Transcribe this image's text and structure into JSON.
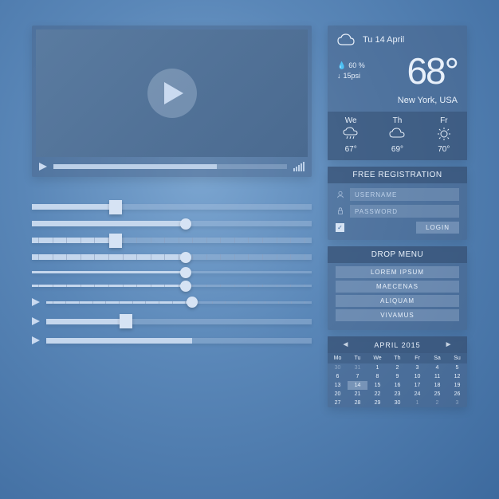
{
  "video": {
    "progress_pct": 70
  },
  "sliders": [
    {
      "fill": 30,
      "thumb": "square",
      "thin": false,
      "ticks": false,
      "play": false
    },
    {
      "fill": 55,
      "thumb": "round",
      "thin": false,
      "ticks": false,
      "play": false
    },
    {
      "fill": 30,
      "thumb": "square",
      "thin": false,
      "ticks": true,
      "play": false
    },
    {
      "fill": 55,
      "thumb": "round",
      "thin": false,
      "ticks": true,
      "play": false
    },
    {
      "fill": 55,
      "thumb": "round",
      "thin": true,
      "ticks": false,
      "play": false
    },
    {
      "fill": 55,
      "thumb": "round",
      "thin": true,
      "ticks": true,
      "play": false
    },
    {
      "fill": 55,
      "thumb": "round",
      "thin": true,
      "ticks": true,
      "play": true
    },
    {
      "fill": 30,
      "thumb": "square",
      "thin": false,
      "ticks": false,
      "play": true
    },
    {
      "fill": 55,
      "thumb": "none",
      "thin": false,
      "ticks": false,
      "play": true
    }
  ],
  "weather": {
    "date": "Tu 14 April",
    "humidity": "60 %",
    "pressure": "15psi",
    "temp": "68°",
    "location": "New York, USA",
    "forecast": [
      {
        "day": "We",
        "temp": "67°",
        "icon": "rain"
      },
      {
        "day": "Th",
        "temp": "69°",
        "icon": "cloud"
      },
      {
        "day": "Fr",
        "temp": "70°",
        "icon": "sun"
      }
    ]
  },
  "registration": {
    "title": "FREE REGISTRATION",
    "username_ph": "USERNAME",
    "password_ph": "PASSWORD",
    "login_label": "LOGIN"
  },
  "menu": {
    "title": "DROP MENU",
    "items": [
      "LOREM IPSUM",
      "MAECENAS",
      "ALIQUAM",
      "VIVAMUS"
    ]
  },
  "calendar": {
    "title": "APRIL 2015",
    "day_headers": [
      "Mo",
      "Tu",
      "We",
      "Th",
      "Fr",
      "Sa",
      "Su"
    ],
    "cells": [
      {
        "n": 30,
        "dim": true
      },
      {
        "n": 31,
        "dim": true
      },
      {
        "n": 1
      },
      {
        "n": 2
      },
      {
        "n": 3
      },
      {
        "n": 4
      },
      {
        "n": 5
      },
      {
        "n": 6
      },
      {
        "n": 7
      },
      {
        "n": 8
      },
      {
        "n": 9
      },
      {
        "n": 10
      },
      {
        "n": 11
      },
      {
        "n": 12
      },
      {
        "n": 13
      },
      {
        "n": 14,
        "hl": true
      },
      {
        "n": 15
      },
      {
        "n": 16
      },
      {
        "n": 17
      },
      {
        "n": 18
      },
      {
        "n": 19
      },
      {
        "n": 20
      },
      {
        "n": 21
      },
      {
        "n": 22
      },
      {
        "n": 23
      },
      {
        "n": 24
      },
      {
        "n": 25
      },
      {
        "n": 26
      },
      {
        "n": 27
      },
      {
        "n": 28
      },
      {
        "n": 29
      },
      {
        "n": 30
      },
      {
        "n": 1,
        "dim": true
      },
      {
        "n": 2,
        "dim": true
      },
      {
        "n": 3,
        "dim": true
      }
    ]
  }
}
